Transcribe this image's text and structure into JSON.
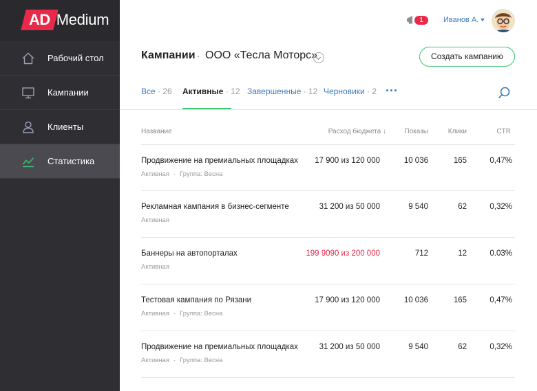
{
  "brand": {
    "ad": "AD",
    "medium": "Medium"
  },
  "nav": [
    {
      "label": "Рабочий стол",
      "icon": "home-icon"
    },
    {
      "label": "Кампании",
      "icon": "monitor-icon"
    },
    {
      "label": "Клиенты",
      "icon": "user-icon"
    },
    {
      "label": "Статистика",
      "icon": "chart-line-icon",
      "active": true
    }
  ],
  "topbar": {
    "notifications": "1",
    "user_name": "Иванов А.",
    "avatar_icon": "avatar-icon"
  },
  "header": {
    "title": "Кампании",
    "separator": "·",
    "company": "ООО «Тесла Моторс»",
    "create_button": "Создать кампанию"
  },
  "tabs": [
    {
      "label": "Все",
      "count": "· 26"
    },
    {
      "label": "Активные",
      "count": "· 12",
      "active": true
    },
    {
      "label": "Завершенные",
      "count": "· 12"
    },
    {
      "label": "Черновики",
      "count": "· 2"
    }
  ],
  "table": {
    "columns": {
      "name": "Название",
      "budget": "Расход бюджета ↓",
      "shows": "Показы",
      "clicks": "Клики",
      "ctr": "CTR"
    },
    "rows": [
      {
        "name": "Продвижение на премиальных площадках",
        "status": "Активная",
        "group": "Группа: Весна",
        "budget": "17 900 из 120 000",
        "shows": "10 036",
        "clicks": "165",
        "ctr": "0,47%",
        "over": false
      },
      {
        "name": "Рекламная кампания в бизнес-сегменте",
        "status": "Активная",
        "group": "",
        "budget": "31 200 из 50 000",
        "shows": "9 540",
        "clicks": "62",
        "ctr": "0,32%",
        "over": false
      },
      {
        "name": "Баннеры на автопорталах",
        "status": "Активная",
        "group": "",
        "budget": "199 9090 из 200 000",
        "shows": "712",
        "clicks": "12",
        "ctr": "0.03%",
        "over": true
      },
      {
        "name": "Тестовая кампания по Рязани",
        "status": "Активная",
        "group": "Группа: Весна",
        "budget": "17 900 из 120 000",
        "shows": "10 036",
        "clicks": "165",
        "ctr": "0,47%",
        "over": false
      },
      {
        "name": "Продвижение на премиальных площадках",
        "status": "Активная",
        "group": "Группа: Весна",
        "budget": "31 200 из 50 000",
        "shows": "9 540",
        "clicks": "62",
        "ctr": "0,32%",
        "over": false
      }
    ]
  },
  "colors": {
    "sidebar": "#2f2f33",
    "sidebar_active": "#4a4a50",
    "brand_red": "#e8294a",
    "accent_green": "#3ac56e",
    "link_blue": "#3a7bbf"
  }
}
